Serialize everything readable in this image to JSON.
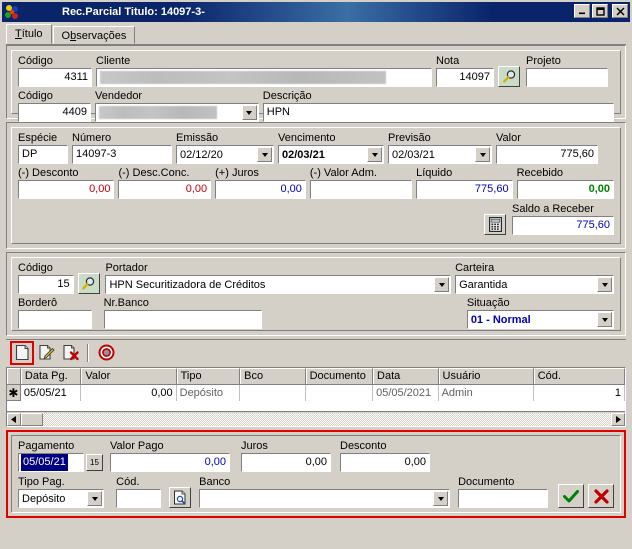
{
  "window": {
    "title": "Rec.Parcial Titulo: 14097-3-",
    "app_icon": "app-logo-icon",
    "minimize": "_",
    "maximize": "□",
    "close": "✕"
  },
  "tabs": [
    {
      "label": "Título",
      "active": true
    },
    {
      "label": "Observações",
      "active": false
    }
  ],
  "header_section": {
    "codigo_cliente_label": "Código",
    "codigo_cliente_value": "4311",
    "cliente_label": "Cliente",
    "cliente_value": "",
    "nota_label": "Nota",
    "nota_value": "14097",
    "nota_search_icon": "magnifier-icon",
    "projeto_label": "Projeto",
    "projeto_value": "",
    "codigo_vendedor_label": "Código",
    "codigo_vendedor_value": "4409",
    "vendedor_label": "Vendedor",
    "vendedor_value": "",
    "descricao_label": "Descrição",
    "descricao_value": "HPN"
  },
  "title_section": {
    "especie_label": "Espécie",
    "especie_value": "DP",
    "numero_label": "Número",
    "numero_value": "14097-3",
    "emissao_label": "Emissão",
    "emissao_value": "02/12/20",
    "vencimento_label": "Vencimento",
    "vencimento_value": "02/03/21",
    "previsao_label": "Previsão",
    "previsao_value": "02/03/21",
    "valor_label": "Valor",
    "valor_value": "775,60",
    "desconto_label": "(-) Desconto",
    "desconto_value": "0,00",
    "desc_conc_label": "(-) Desc.Conc.",
    "desc_conc_value": "0,00",
    "juros_label": "(+) Juros",
    "juros_value": "0,00",
    "valor_adm_label": "(-) Valor Adm.",
    "valor_adm_value": "",
    "liquido_label": "Líquido",
    "liquido_value": "775,60",
    "recebido_label": "Recebido",
    "recebido_value": "0,00",
    "calc_icon": "calculator-icon",
    "saldo_label": "Saldo a Receber",
    "saldo_value": "775,60"
  },
  "portador_section": {
    "codigo_label": "Código",
    "codigo_value": "15",
    "portador_search_icon": "magnifier-icon",
    "portador_label": "Portador",
    "portador_value": "HPN Securitizadora de Créditos",
    "carteira_label": "Carteira",
    "carteira_value": "Garantida",
    "bordero_label": "Borderô",
    "bordero_value": "",
    "nr_banco_label": "Nr.Banco",
    "nr_banco_value": "",
    "situacao_label": "Situação",
    "situacao_value": "01 - Normal"
  },
  "toolbar": {
    "new_icon": "new-document-icon",
    "edit_icon": "edit-document-icon",
    "delete_icon": "delete-document-icon",
    "cancel_icon": "stop-cancel-icon"
  },
  "grid": {
    "columns": [
      "Data Pg.",
      "Valor",
      "Tipo",
      "Bco",
      "Documento",
      "Data",
      "Usuário",
      "Cód."
    ],
    "rows": [
      {
        "marker": "✱",
        "cells": [
          "05/05/21",
          "0,00",
          "Depósito",
          "",
          "",
          "05/05/2021",
          "Admin",
          "1"
        ]
      }
    ],
    "scroll_left_icon": "scroll-left-icon",
    "scroll_right_icon": "scroll-right-icon"
  },
  "payment_panel": {
    "pagamento_label": "Pagamento",
    "pagamento_value": "05/05/21",
    "calendar_icon": "calendar-icon",
    "calendar_day": "15",
    "valor_pago_label": "Valor Pago",
    "valor_pago_value": "0,00",
    "juros_label": "Juros",
    "juros_value": "0,00",
    "desconto_label": "Desconto",
    "desconto_value": "0,00",
    "tipo_pag_label": "Tipo Pag.",
    "tipo_pag_value": "Depósito",
    "cod_label": "Cód.",
    "cod_value": "",
    "banco_lookup_icon": "document-search-icon",
    "banco_label": "Banco",
    "banco_value": "",
    "documento_label": "Documento",
    "documento_value": "",
    "confirm_icon": "check-icon",
    "cancel_icon": "cross-icon"
  },
  "colors": {
    "accent_blue": "#0000c0",
    "accent_red": "#c00000",
    "accent_green": "#008000",
    "highlight_red": "#e00000",
    "titlebar_blue": "#0a246a",
    "face": "#d4d0c8"
  }
}
